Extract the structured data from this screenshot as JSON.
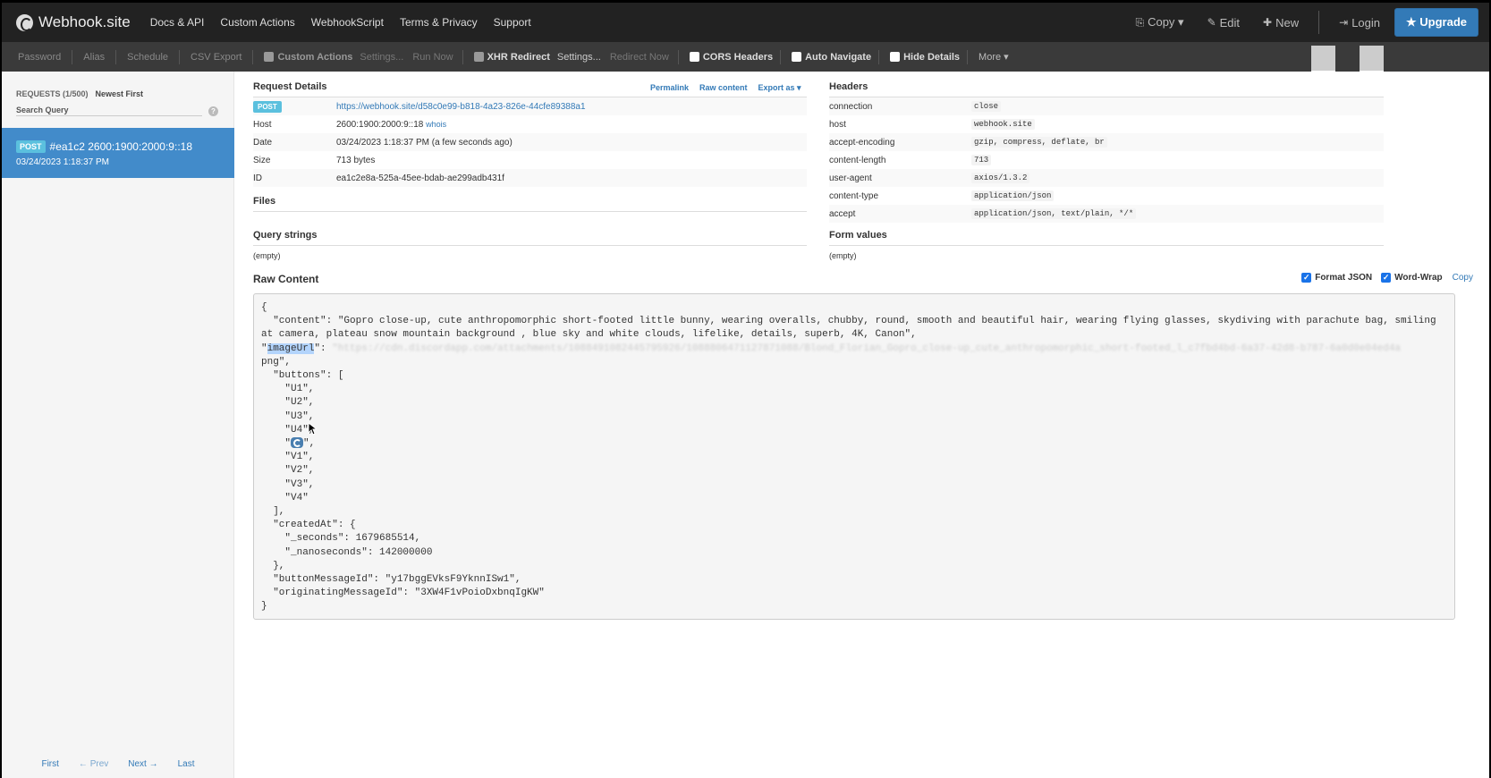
{
  "brand": {
    "name": "Webhook.site"
  },
  "nav": {
    "left": [
      "Docs & API",
      "Custom Actions",
      "WebhookScript",
      "Terms & Privacy",
      "Support"
    ],
    "copy": "Copy ▾",
    "edit": "Edit",
    "new": "New",
    "login": "Login",
    "upgrade": "★ Upgrade"
  },
  "toolbar": {
    "password": "Password",
    "alias": "Alias",
    "schedule": "Schedule",
    "csv_export": "CSV Export",
    "custom_actions": "Custom Actions",
    "settings1": "Settings...",
    "run_now": "Run Now",
    "xhr_redirect": "XHR Redirect",
    "settings2": "Settings...",
    "redirect_now": "Redirect Now",
    "cors_headers": "CORS Headers",
    "auto_navigate": "Auto Navigate",
    "hide_details": "Hide Details",
    "more": "More ▾"
  },
  "sidebar": {
    "requests_label": "REQUESTS (1/500)",
    "sort_label": "Newest First",
    "search_placeholder": "Search Query",
    "help": "?",
    "item": {
      "method": "POST",
      "title": "#ea1c2 2600:1900:2000:9::18",
      "time": "03/24/2023 1:18:37 PM"
    },
    "pager": {
      "first": "First",
      "prev": "← Prev",
      "next": "Next →",
      "last": "Last"
    }
  },
  "details": {
    "title": "Request Details",
    "permalink": "Permalink",
    "raw_content_link": "Raw content",
    "export_as": "Export as ▾",
    "method": "POST",
    "url": "https://webhook.site/d58c0e99-b818-4a23-826e-44cfe89388a1",
    "host_label": "Host",
    "host_value": "2600:1900:2000:9::18",
    "whois": "whois",
    "date_label": "Date",
    "date_value": "03/24/2023 1:18:37 PM (a few seconds ago)",
    "size_label": "Size",
    "size_value": "713 bytes",
    "id_label": "ID",
    "id_value": "ea1c2e8a-525a-45ee-bdab-ae299adb431f",
    "files_title": "Files",
    "query_title": "Query strings",
    "query_empty": "(empty)"
  },
  "headers": {
    "title": "Headers",
    "rows": [
      {
        "k": "connection",
        "v": "close"
      },
      {
        "k": "host",
        "v": "webhook.site"
      },
      {
        "k": "accept-encoding",
        "v": "gzip, compress, deflate, br"
      },
      {
        "k": "content-length",
        "v": "713"
      },
      {
        "k": "user-agent",
        "v": "axios/1.3.2"
      },
      {
        "k": "content-type",
        "v": "application/json"
      },
      {
        "k": "accept",
        "v": "application/json, text/plain, */*"
      }
    ],
    "form_title": "Form values",
    "form_empty": "(empty)"
  },
  "raw": {
    "title": "Raw Content",
    "format_json": "Format JSON",
    "word_wrap": "Word-Wrap",
    "copy": "Copy",
    "l_open": "{",
    "l_content": "  \"content\": \"Gopro close-up, cute anthropomorphic short-footed little bunny, wearing overalls, chubby, round, smooth and beautiful hair, wearing flying glasses, skydiving with parachute bag, smiling at camera, plateau snow mountain background , blue sky and white clouds, lifelike, details, superb, 4K, Canon\",",
    "l_image_key": "imageUrl",
    "l_image_blur": "\"https://cdn.discordapp.com/attachments/1088491082445795926/1088806471127871088/Blond_Florian_Gopro_close-up_cute_anthropomorphic_short-footed_l_c7fbd4bd-6a37-42d8-b787-6a0d0e04ed4a",
    "l_image_end": "png\",",
    "l_buttons_open": "  \"buttons\": [",
    "buttons": [
      "\"U1\",",
      "\"U2\",",
      "\"U3\",",
      "\"U4\","
    ],
    "buttons2": [
      "\"V1\",",
      "\"V2\",",
      "\"V3\",",
      "\"V4\""
    ],
    "l_buttons_close": "  ],",
    "l_created": "  \"createdAt\": {",
    "l_seconds": "    \"_seconds\": 1679685514,",
    "l_nanos": "    \"_nanoseconds\": 142000000",
    "l_created_close": "  },",
    "l_button_msg": "  \"buttonMessageId\": \"y17bggEVksF9YknnISw1\",",
    "l_orig_msg": "  \"originatingMessageId\": \"3XW4F1vPoioDxbnqIgKW\"",
    "l_close": "}"
  }
}
